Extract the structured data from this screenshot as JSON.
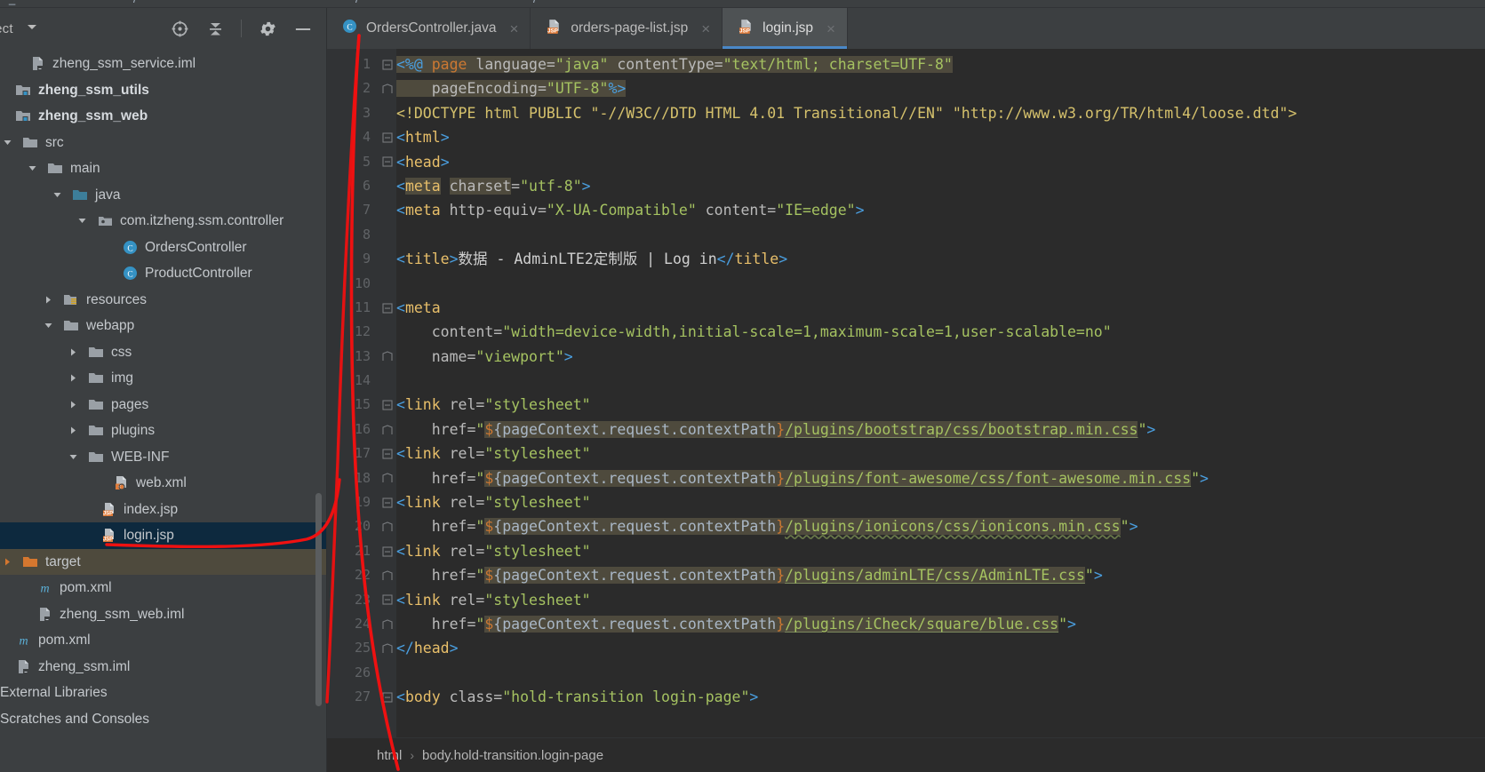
{
  "window": {
    "top_strip_fragments": [
      "/",
      "",
      "/",
      "",
      "",
      "/",
      "",
      "/",
      "",
      "/",
      ""
    ]
  },
  "project_panel": {
    "title": "oject",
    "tools": [
      {
        "name": "locate-icon",
        "label": "Select Opened File"
      },
      {
        "name": "collapse-all-icon",
        "label": "Collapse All"
      },
      {
        "name": "gear-icon",
        "label": "Settings"
      },
      {
        "name": "minimize-icon",
        "label": "Hide"
      }
    ],
    "tree": [
      {
        "label": "zheng_ssm_service.iml",
        "indent": 1,
        "arrow": "none",
        "icon": "iml-file-icon",
        "state": "normal"
      },
      {
        "label": "zheng_ssm_utils",
        "indent": 0,
        "arrow": "none",
        "icon": "module-icon",
        "state": "bold"
      },
      {
        "label": "zheng_ssm_web",
        "indent": 0,
        "arrow": "none",
        "icon": "module-icon",
        "state": "bold"
      },
      {
        "label": "src",
        "indent": 0,
        "arrow": "down",
        "icon": "folder-icon",
        "state": "normal"
      },
      {
        "label": "main",
        "indent": 1,
        "arrow": "down",
        "icon": "folder-icon",
        "state": "normal"
      },
      {
        "label": "java",
        "indent": 2,
        "arrow": "down",
        "icon": "source-root-icon",
        "state": "normal"
      },
      {
        "label": "com.itzheng.ssm.controller",
        "indent": 3,
        "arrow": "down",
        "icon": "package-icon",
        "state": "normal"
      },
      {
        "label": "OrdersController",
        "indent": 4,
        "arrow": "none",
        "icon": "java-class-icon",
        "state": "normal"
      },
      {
        "label": "ProductController",
        "indent": 4,
        "arrow": "none",
        "icon": "java-class-icon",
        "state": "normal"
      },
      {
        "label": "resources",
        "indent": 2,
        "arrow": "right",
        "icon": "resources-root-icon",
        "state": "normal"
      },
      {
        "label": "webapp",
        "indent": 2,
        "arrow": "down",
        "icon": "folder-icon",
        "state": "normal"
      },
      {
        "label": "css",
        "indent": 3,
        "arrow": "right",
        "icon": "folder-icon",
        "state": "normal"
      },
      {
        "label": "img",
        "indent": 3,
        "arrow": "right",
        "icon": "folder-icon",
        "state": "normal"
      },
      {
        "label": "pages",
        "indent": 3,
        "arrow": "right",
        "icon": "folder-icon",
        "state": "normal"
      },
      {
        "label": "plugins",
        "indent": 3,
        "arrow": "right",
        "icon": "folder-icon",
        "state": "normal"
      },
      {
        "label": "WEB-INF",
        "indent": 3,
        "arrow": "down",
        "icon": "folder-icon",
        "state": "normal"
      },
      {
        "label": "web.xml",
        "indent": 4,
        "arrow": "none",
        "icon": "web-xml-icon",
        "state": "normal"
      },
      {
        "label": "index.jsp",
        "indent": 3,
        "arrow": "none",
        "icon": "jsp-file-icon",
        "state": "normal"
      },
      {
        "label": "login.jsp",
        "indent": 3,
        "arrow": "none",
        "icon": "jsp-file-icon",
        "state": "selected"
      },
      {
        "label": "target",
        "indent": 0,
        "arrow": "right",
        "icon": "excluded-folder-icon",
        "state": "context"
      },
      {
        "label": "pom.xml",
        "indent": 1,
        "arrow": "none",
        "icon": "maven-icon",
        "state": "normal"
      },
      {
        "label": "zheng_ssm_web.iml",
        "indent": 1,
        "arrow": "none",
        "icon": "iml-file-icon",
        "state": "normal"
      },
      {
        "label": "pom.xml",
        "indent": 0,
        "arrow": "none",
        "icon": "maven-icon",
        "state": "normal"
      },
      {
        "label": "zheng_ssm.iml",
        "indent": 0,
        "arrow": "none",
        "icon": "iml-file-icon",
        "state": "normal"
      },
      {
        "label": "External Libraries",
        "indent": -1,
        "arrow": "none",
        "icon": "none",
        "state": "normal"
      },
      {
        "label": "Scratches and Consoles",
        "indent": -1,
        "arrow": "none",
        "icon": "none",
        "state": "normal"
      }
    ]
  },
  "tabs": [
    {
      "label": "OrdersController.java",
      "icon": "java-class-icon",
      "active": false,
      "close": "×"
    },
    {
      "label": "orders-page-list.jsp",
      "icon": "jsp-file-icon",
      "active": false,
      "close": "×"
    },
    {
      "label": "login.jsp",
      "icon": "jsp-file-icon",
      "active": true,
      "close": "×"
    }
  ],
  "editor": {
    "filename": "login.jsp",
    "line_numbers": [
      "1",
      "2",
      "3",
      "4",
      "5",
      "6",
      "7",
      "8",
      "9",
      "10",
      "11",
      "12",
      "13",
      "14",
      "15",
      "16",
      "17",
      "18",
      "19",
      "20",
      "21",
      "22",
      "23",
      "24",
      "25",
      "26",
      "27"
    ],
    "lines": [
      "<%@ page language=\"java\" contentType=\"text/html; charset=UTF-8\"",
      "    pageEncoding=\"UTF-8\"%>",
      "<!DOCTYPE html PUBLIC \"-//W3C//DTD HTML 4.01 Transitional//EN\" \"http://www.w3.org/TR/html4/loose.dtd\">",
      "<html>",
      "<head>",
      "<meta charset=\"utf-8\">",
      "<meta http-equiv=\"X-UA-Compatible\" content=\"IE=edge\">",
      "",
      "<title>数据 - AdminLTE2定制版 | Log in</title>",
      "",
      "<meta",
      "    content=\"width=device-width,initial-scale=1,maximum-scale=1,user-scalable=no\"",
      "    name=\"viewport\">",
      "",
      "<link rel=\"stylesheet\"",
      "    href=\"${pageContext.request.contextPath}/plugins/bootstrap/css/bootstrap.min.css\">",
      "<link rel=\"stylesheet\"",
      "    href=\"${pageContext.request.contextPath}/plugins/font-awesome/css/font-awesome.min.css\">",
      "<link rel=\"stylesheet\"",
      "    href=\"${pageContext.request.contextPath}/plugins/ionicons/css/ionicons.min.css\">",
      "<link rel=\"stylesheet\"",
      "    href=\"${pageContext.request.contextPath}/plugins/adminLTE/css/AdminLTE.css\">",
      "<link rel=\"stylesheet\"",
      "    href=\"${pageContext.request.contextPath}/plugins/iCheck/square/blue.css\">",
      "</head>",
      "",
      "<body class=\"hold-transition login-page\">"
    ]
  },
  "breadcrumb": {
    "items": [
      "html",
      "body.hold-transition.login-page"
    ],
    "separator": "›"
  },
  "colors": {
    "panel_bg": "#3c3f41",
    "editor_bg": "#2b2b2b",
    "gutter_bg": "#313335",
    "selection_bg": "#0d293e",
    "context_bg": "#4e4a3d",
    "active_tab_bg": "#4e5254",
    "tab_underline": "#4a88c7",
    "string_green": "#a5c261",
    "tag_yellow": "#e8bf6a",
    "keyword_orange": "#cc7832",
    "annotation_red": "#ee1111"
  }
}
